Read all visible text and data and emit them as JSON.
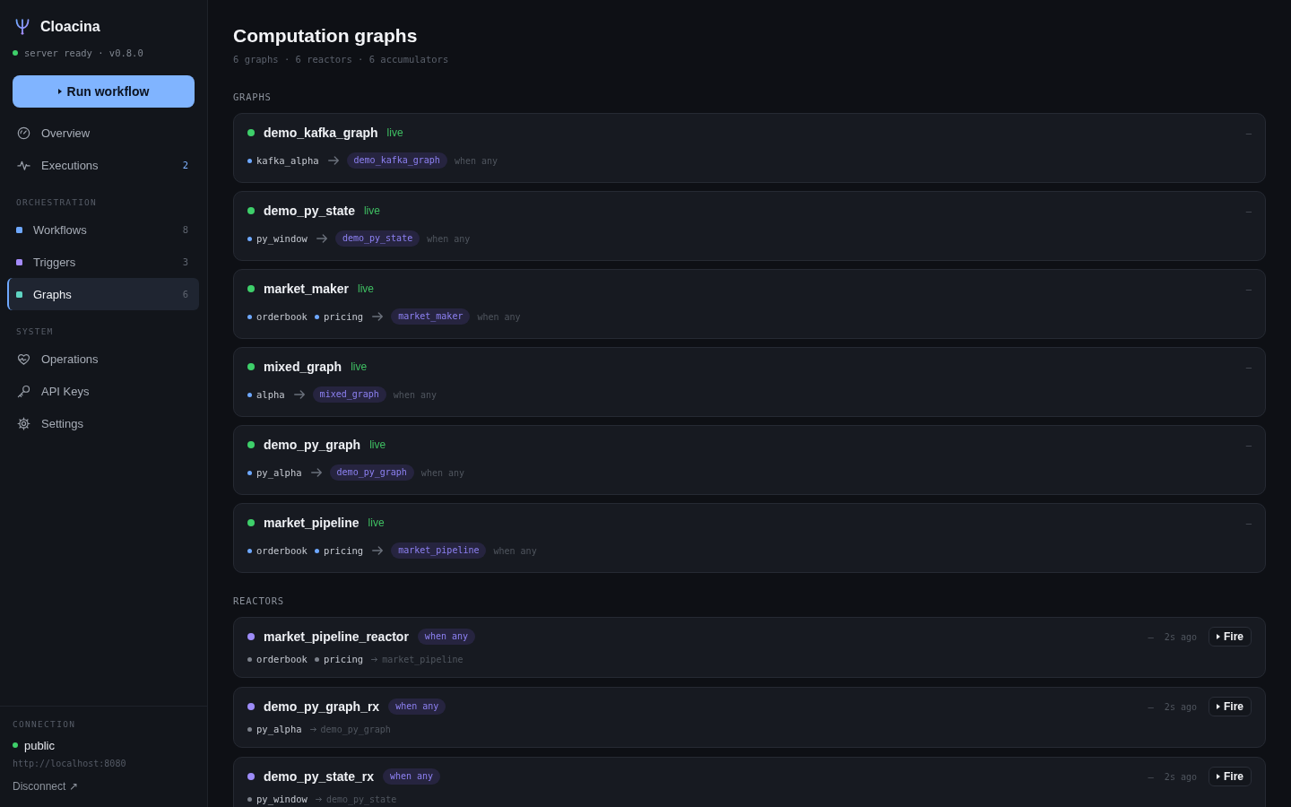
{
  "sidebar": {
    "brand": {
      "name": "Cloacina"
    },
    "server_status": {
      "online": true,
      "text": "server ready · v0.8.0"
    },
    "primary_action": {
      "label": "Run workflow"
    },
    "sections": [
      {
        "items": [
          {
            "label": "Overview",
            "selected": false
          },
          {
            "label": "Executions",
            "count": "2",
            "count_active": true,
            "selected": false
          }
        ]
      },
      {
        "title": "ORCHESTRATION",
        "items": [
          {
            "label": "Workflows",
            "count": "8",
            "count_active": false,
            "color": "#6ea8fe",
            "selected": false
          },
          {
            "label": "Triggers",
            "count": "3",
            "count_active": false,
            "color": "#a48bfa",
            "selected": false
          },
          {
            "label": "Graphs",
            "count": "6",
            "count_active": false,
            "color": "#5fd4c2",
            "selected": true
          }
        ]
      },
      {
        "title": "SYSTEM",
        "items": [
          {
            "label": "Operations",
            "selected": false
          },
          {
            "label": "API Keys",
            "selected": false
          },
          {
            "label": "Settings",
            "selected": false
          }
        ]
      }
    ],
    "connection": {
      "title": "CONNECTION",
      "online": true,
      "name": "public",
      "url": "http://localhost:8080",
      "action": "Disconnect ↗"
    }
  },
  "header": {
    "title": "Computation graphs",
    "summary": "6 graphs · 6 reactors · 6 accumulators"
  },
  "graphs": {
    "title": "GRAPHS",
    "items": [
      {
        "name": "demo_kafka_graph",
        "status": "live",
        "live": true,
        "value": "—",
        "sources": [
          "kafka_alpha"
        ],
        "target": "demo_kafka_graph",
        "condition": "when any"
      },
      {
        "name": "demo_py_state",
        "status": "live",
        "live": true,
        "value": "—",
        "sources": [
          "py_window"
        ],
        "target": "demo_py_state",
        "condition": "when any"
      },
      {
        "name": "market_maker",
        "status": "live",
        "live": true,
        "value": "—",
        "sources": [
          "orderbook",
          "pricing"
        ],
        "target": "market_maker",
        "condition": "when any"
      },
      {
        "name": "mixed_graph",
        "status": "live",
        "live": true,
        "value": "—",
        "sources": [
          "alpha"
        ],
        "target": "mixed_graph",
        "condition": "when any"
      },
      {
        "name": "demo_py_graph",
        "status": "live",
        "live": true,
        "value": "—",
        "sources": [
          "py_alpha"
        ],
        "target": "demo_py_graph",
        "condition": "when any"
      },
      {
        "name": "market_pipeline",
        "status": "live",
        "live": true,
        "value": "—",
        "sources": [
          "orderbook",
          "pricing"
        ],
        "target": "market_pipeline",
        "condition": "when any"
      }
    ]
  },
  "reactors": {
    "title": "REACTORS",
    "items": [
      {
        "name": "market_pipeline_reactor",
        "condition": "when any",
        "value": "—",
        "last_fired": "2s ago",
        "action": "Fire",
        "sources": [
          "orderbook",
          "pricing"
        ],
        "target": "market_pipeline"
      },
      {
        "name": "demo_py_graph_rx",
        "condition": "when any",
        "value": "—",
        "last_fired": "2s ago",
        "action": "Fire",
        "sources": [
          "py_alpha"
        ],
        "target": "demo_py_graph"
      },
      {
        "name": "demo_py_state_rx",
        "condition": "when any",
        "value": "—",
        "last_fired": "2s ago",
        "action": "Fire",
        "sources": [
          "py_window"
        ],
        "target": "demo_py_state"
      }
    ]
  }
}
